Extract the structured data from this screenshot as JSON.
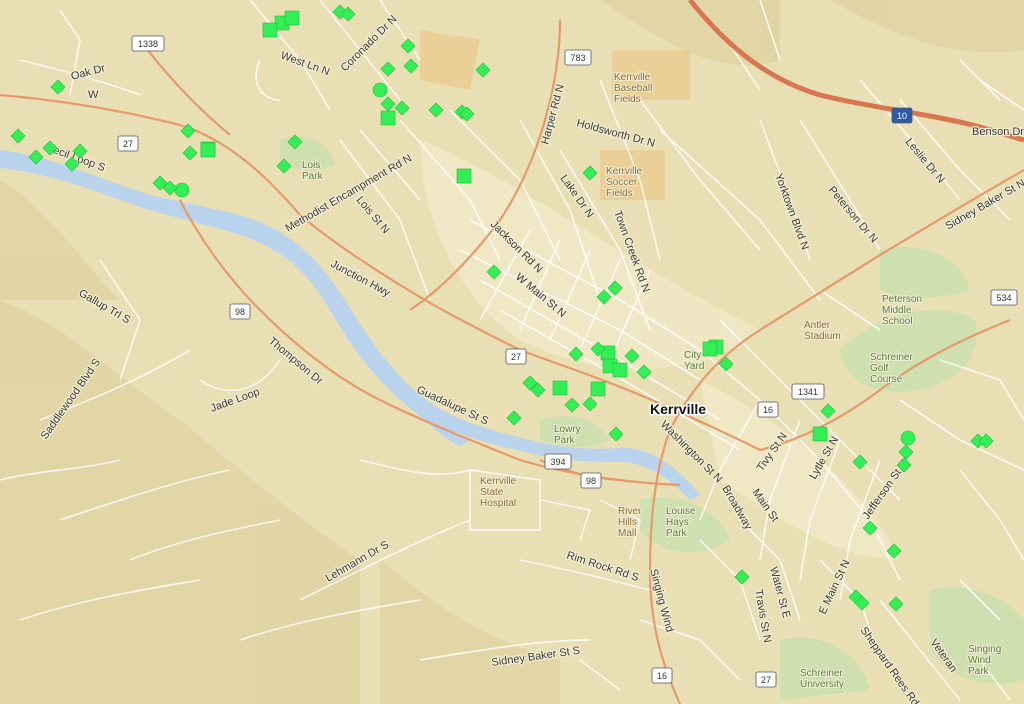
{
  "map": {
    "city_label": "Kerrville",
    "colors": {
      "terrain": "#e9dfb4",
      "river": "#b9d3ec",
      "road_major": "#e59a6a",
      "interstate": "#d8774f",
      "road_minor": "#ffffff",
      "park": "#cfe0b0",
      "marker": "#33ee55"
    },
    "streets": [
      "Oak Dr",
      "W",
      "West Ln N",
      "Coronado Dr N",
      "Methodist Encampment Rd N",
      "Lois St N",
      "Cecil Loop S",
      "Junction Hwy",
      "Gallup Trl S",
      "Thompson Dr",
      "Jade Loop",
      "Saddlewood Blvd S",
      "Guadalupe St S",
      "Harper Rd N",
      "Holdsworth Dr N",
      "Lake Dr N",
      "Jackson Rd N",
      "W Main St N",
      "Town Creek Rd N",
      "Yorktown Blvd N",
      "Peterson Dr N",
      "Leslie Dr N",
      "Sidney Baker St N",
      "Benson Dr",
      "Kerrville",
      "Main St",
      "Washington St N",
      "Tivy St N",
      "Lytle St N",
      "Jefferson St N",
      "Main St",
      "Broadway",
      "Water St E",
      "Travis St N",
      "E Main St N",
      "Sheppard Rees Rd S",
      "Lehmann Dr S",
      "Rim Rock Rd S",
      "Sidney Baker St S",
      "Singing Wind",
      "Veteran"
    ],
    "places": [
      "Kerrville Baseball Fields",
      "Kerrville Soccer Fields",
      "Lois Park",
      "Peterson Middle School",
      "Antler Stadium",
      "Schreiner Golf Course",
      "City Yard",
      "Lowry Park",
      "Kerrville State Hospital",
      "River Hills Mall",
      "Louise Hays Park",
      "Schreiner University",
      "Singing Wind Park"
    ],
    "shields": [
      "1338",
      "783",
      "27",
      "98",
      "27",
      "394",
      "98",
      "16",
      "1341",
      "534",
      "16",
      "27",
      "10"
    ],
    "markers": [
      {
        "shape": "diamond"
      },
      {
        "shape": "square"
      },
      {
        "shape": "square"
      },
      {
        "shape": "diamond"
      },
      {
        "shape": "diamond"
      },
      {
        "shape": "diamond"
      },
      {
        "shape": "diamond"
      },
      {
        "shape": "diamond"
      },
      {
        "shape": "circle"
      },
      {
        "shape": "diamond"
      },
      {
        "shape": "square"
      },
      {
        "shape": "diamond"
      },
      {
        "shape": "diamond"
      },
      {
        "shape": "diamond"
      },
      {
        "shape": "diamond"
      },
      {
        "shape": "diamond"
      },
      {
        "shape": "square"
      },
      {
        "shape": "diamond"
      },
      {
        "shape": "diamond"
      },
      {
        "shape": "diamond"
      },
      {
        "shape": "diamond"
      },
      {
        "shape": "diamond"
      },
      {
        "shape": "diamond"
      },
      {
        "shape": "circle"
      },
      {
        "shape": "diamond"
      },
      {
        "shape": "square"
      },
      {
        "shape": "diamond"
      },
      {
        "shape": "square"
      },
      {
        "shape": "diamond"
      },
      {
        "shape": "diamond"
      },
      {
        "shape": "square"
      },
      {
        "shape": "diamond"
      },
      {
        "shape": "diamond"
      },
      {
        "shape": "square"
      },
      {
        "shape": "square"
      },
      {
        "shape": "diamond"
      },
      {
        "shape": "diamond"
      },
      {
        "shape": "diamond"
      },
      {
        "shape": "square"
      },
      {
        "shape": "diamond"
      },
      {
        "shape": "diamond"
      },
      {
        "shape": "square"
      },
      {
        "shape": "square"
      },
      {
        "shape": "diamond"
      },
      {
        "shape": "diamond"
      },
      {
        "shape": "diamond"
      },
      {
        "shape": "diamond"
      },
      {
        "shape": "diamond"
      },
      {
        "shape": "diamond"
      },
      {
        "shape": "square"
      },
      {
        "shape": "square"
      },
      {
        "shape": "diamond"
      },
      {
        "shape": "diamond"
      },
      {
        "shape": "diamond"
      },
      {
        "shape": "square"
      },
      {
        "shape": "diamond"
      },
      {
        "shape": "circle"
      },
      {
        "shape": "diamond"
      },
      {
        "shape": "diamond"
      },
      {
        "shape": "diamond"
      },
      {
        "shape": "diamond"
      },
      {
        "shape": "diamond"
      },
      {
        "shape": "diamond"
      },
      {
        "shape": "diamond"
      },
      {
        "shape": "diamond"
      },
      {
        "shape": "diamond"
      },
      {
        "shape": "diamond"
      },
      {
        "shape": "diamond"
      }
    ]
  }
}
